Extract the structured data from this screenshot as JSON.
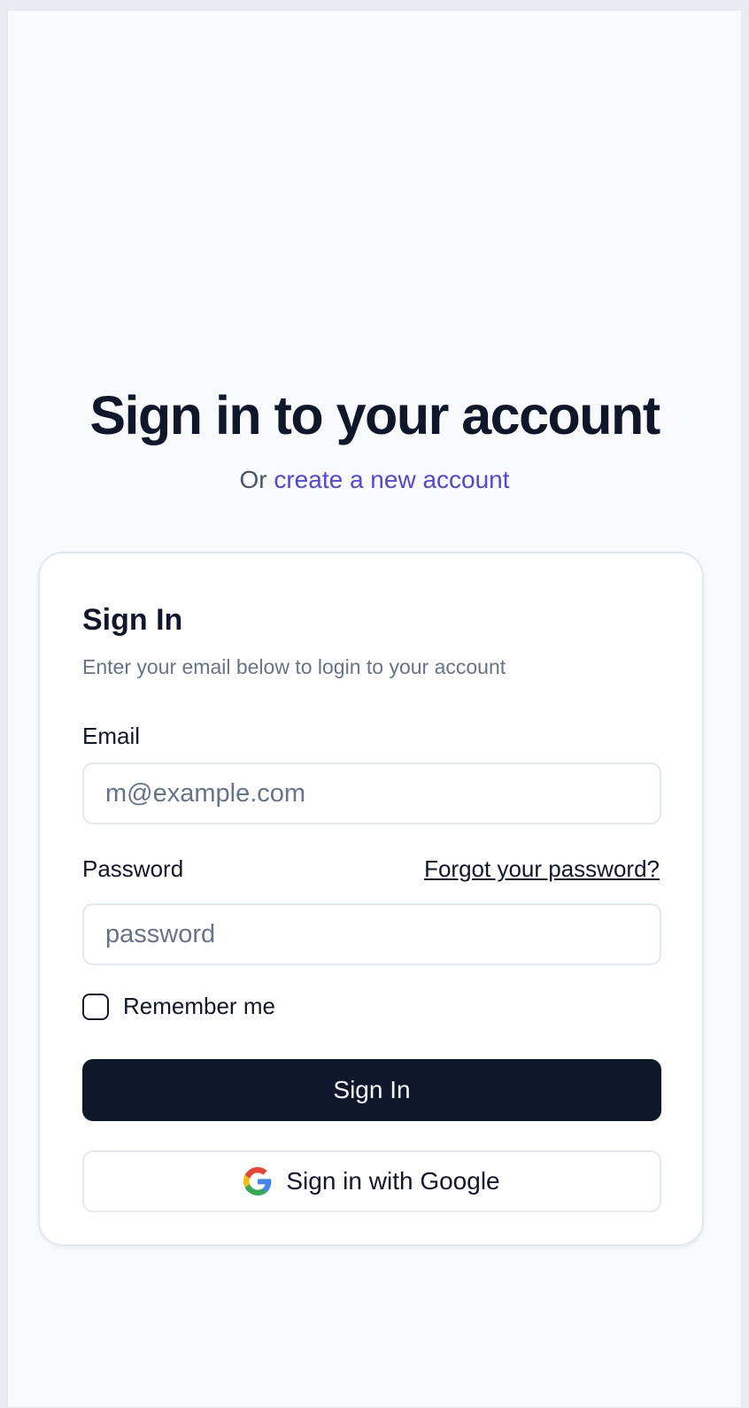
{
  "page": {
    "heading": "Sign in to your account",
    "subheading_prefix": "Or",
    "create_account_link": "create a new account"
  },
  "card": {
    "title": "Sign In",
    "description": "Enter your email below to login to your account",
    "email": {
      "label": "Email",
      "placeholder": "m@example.com",
      "value": ""
    },
    "password": {
      "label": "Password",
      "placeholder": "password",
      "value": "",
      "forgot_link": "Forgot your password?"
    },
    "remember": {
      "label": "Remember me",
      "checked": false
    },
    "sign_in_button": "Sign In",
    "google_button": "Sign in with Google",
    "google_icon": "google-icon"
  },
  "colors": {
    "background": "#f8fafc",
    "primary": "#0f172a",
    "link": "#4f46e5",
    "muted_text": "#64748b",
    "border": "#e2e8f0"
  }
}
